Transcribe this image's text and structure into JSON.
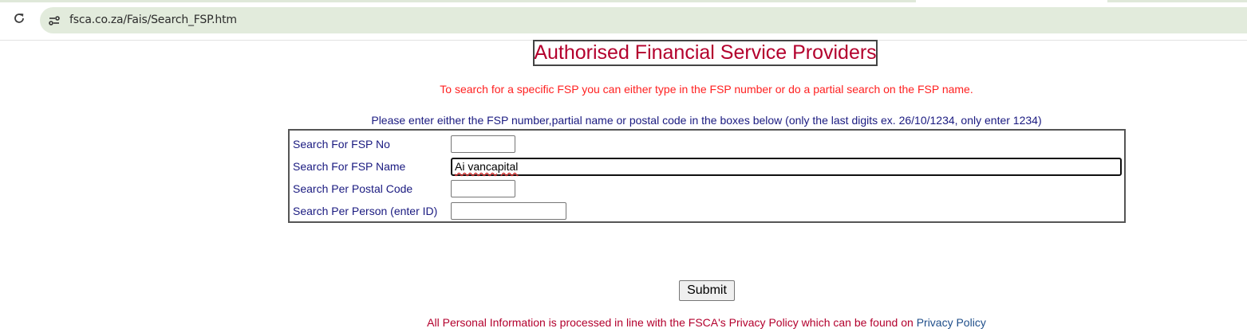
{
  "browser": {
    "url": "fsca.co.za/Fais/Search_FSP.htm",
    "reload_icon": "reload-icon",
    "site_info_icon": "site-settings-icon"
  },
  "page": {
    "title": "Authorised Financial Service Providers",
    "search_hint": "To search for a specific FSP you can either type in the FSP number or do a partial search on the FSP name.",
    "instructions": "Please enter either the FSP number,partial name or postal code in the boxes below (only the last digits ex. 26/10/1234, only enter 1234)",
    "title_color": "#b3002d",
    "hint_color": "#ff2020",
    "label_color": "#1a1a80"
  },
  "form": {
    "fsp_no": {
      "label": "Search For FSP No",
      "value": ""
    },
    "fsp_name": {
      "label": "Search For FSP Name",
      "value": "Ai vancapital"
    },
    "postal_code": {
      "label": "Search Per Postal Code",
      "value": ""
    },
    "person_id": {
      "label": "Search Per Person (enter ID)",
      "value": ""
    },
    "submit_label": "Submit"
  },
  "footer": {
    "privacy_text": "All Personal Information is processed in line with the FSCA's Privacy Policy which can be found on ",
    "privacy_link": "Privacy Policy"
  }
}
